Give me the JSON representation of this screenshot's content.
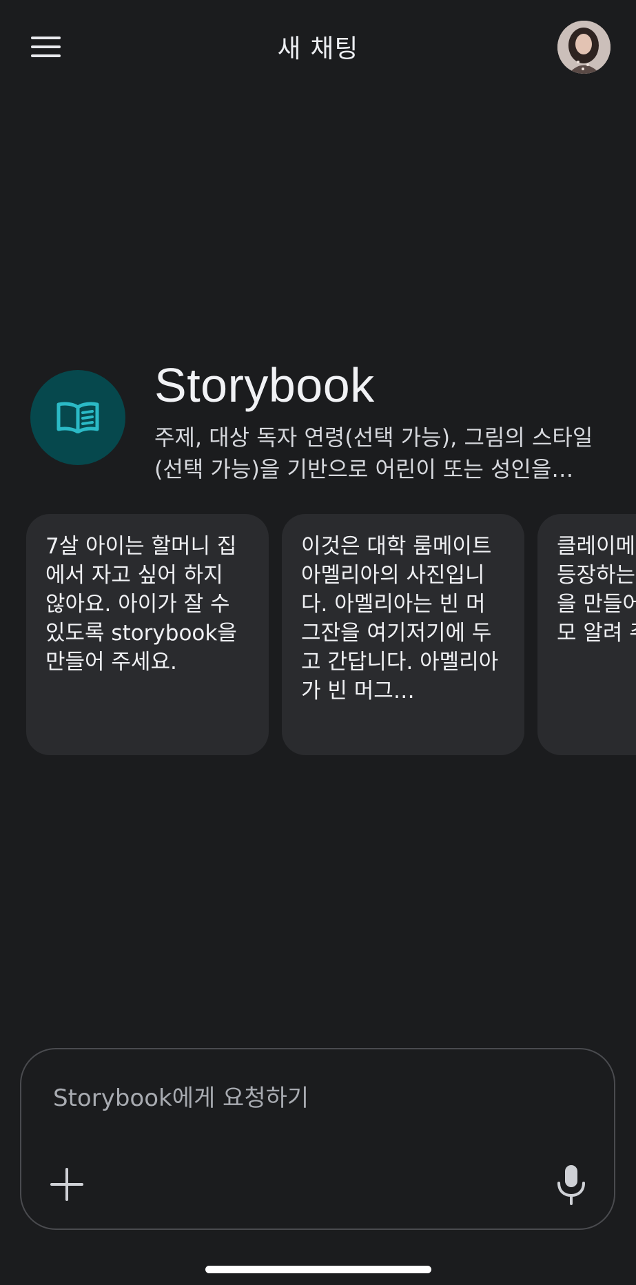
{
  "header": {
    "title": "새 채팅"
  },
  "agent": {
    "name": "Storybook",
    "description": "주제, 대상 독자 연령(선택 가능), 그림의 스타일(선택 가능)을 기반으로 어린이 또는 성인을…"
  },
  "suggestions": [
    {
      "text": "7살 아이는 할머니 집에서 자고 싶어 하지 않아요. 아이가 잘 수 있도록 storybook을 만들어 주세요."
    },
    {
      "text": "이것은 대학 룸메이트 아멜리아의 사진입니다. 아멜리아는 빈 머그잔을 여기저기에 두고 간답니다. 아멜리아가 빈 머그…"
    },
    {
      "text": "클레이메이션 스타일로 등장하는 storybook을 만들어 밝 얼마나 모 알려 주세"
    }
  ],
  "composer": {
    "placeholder": "Storybook에게 요청하기"
  },
  "icons": {
    "menu": "hamburger-menu-icon",
    "avatar": "user-avatar",
    "agent": "open-book-icon",
    "add": "plus-icon",
    "mic": "microphone-icon"
  },
  "colors": {
    "background": "#1b1c1e",
    "card": "#2a2b2e",
    "agent_icon_bg": "#06484d",
    "agent_icon_fg": "#2bbac6"
  }
}
